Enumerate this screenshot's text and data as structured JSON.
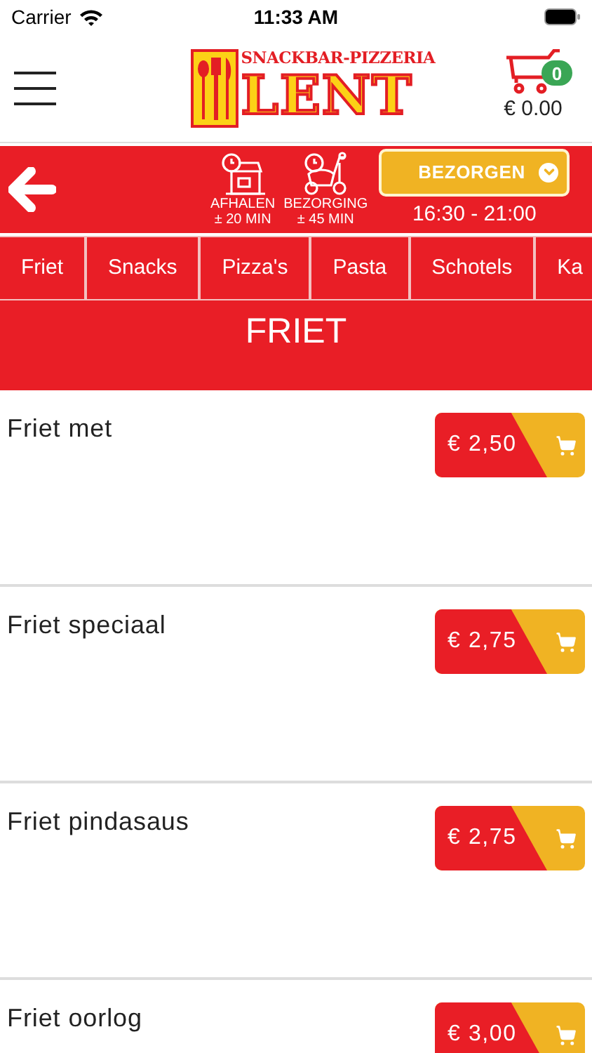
{
  "status_bar": {
    "carrier": "Carrier",
    "time": "11:33 AM"
  },
  "header": {
    "logo_top": "SNACKBAR-PIZZERIA",
    "logo_main": "LENT",
    "cart_count": "0",
    "cart_total": "€ 0.00"
  },
  "info_bar": {
    "pickup": {
      "label": "AFHALEN",
      "time": "± 20 MIN"
    },
    "delivery": {
      "label": "BEZORGING",
      "time": "± 45 MIN"
    },
    "mode_button": "BEZORGEN",
    "hours": "16:30 - 21:00"
  },
  "tabs": [
    "Friet",
    "Snacks",
    "Pizza's",
    "Pasta",
    "Schotels",
    "Ka"
  ],
  "section_title": "FRIET",
  "products": [
    {
      "name": "Friet met",
      "price": "€ 2,50"
    },
    {
      "name": "Friet speciaal",
      "price": "€ 2,75"
    },
    {
      "name": "Friet pindasaus",
      "price": "€ 2,75"
    },
    {
      "name": "Friet oorlog",
      "price": "€ 3,00"
    }
  ]
}
